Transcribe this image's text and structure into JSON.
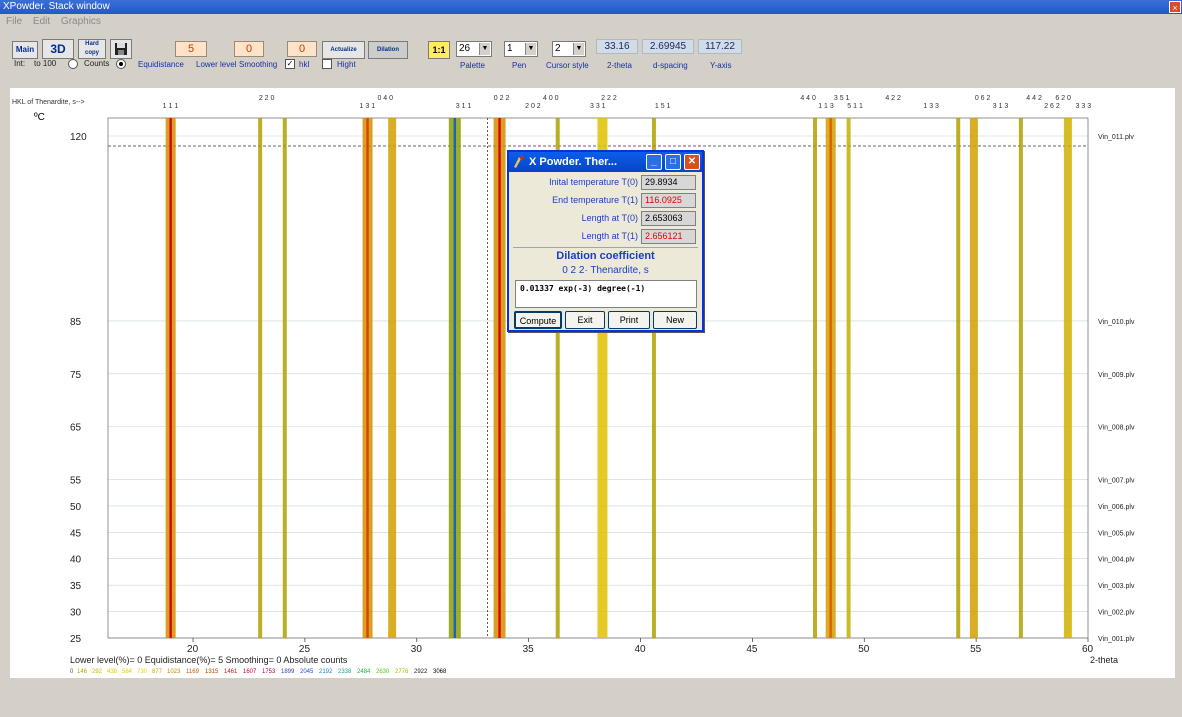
{
  "window": {
    "title": "XPowder. Stack window",
    "close_glyph": "×"
  },
  "menu": [
    "File",
    "Edit",
    "Graphics"
  ],
  "toolbar": {
    "main_label": "Main",
    "btn3d_label": "3D",
    "hardcopy_label": "Hard copy",
    "save_icon": "floppy-icon",
    "numbox1": "5",
    "numbox2": "0",
    "numbox3": "0",
    "actualize_label": "Actualize",
    "dilation_label": "Dilation",
    "ratio_label": "1:1",
    "palette_value": "26",
    "pen_value": "1",
    "cursor_value": "2",
    "two_theta_value": "33.16",
    "dspacing_value": "2.69945",
    "yaxis_value": "117.22",
    "int_label": "Int:",
    "to100_label": "to 100",
    "counts_label": "Counts",
    "equidistance_label": "Equidistance",
    "lowerlevel_label": "Lower level",
    "smoothing_label": "Smoothing",
    "hkl_label": "hkl",
    "hight_label": "Hight",
    "palette_label": "Palette",
    "pen_label": "Pen",
    "cursor_label": "Cursor style",
    "two_theta_label": "2-theta",
    "dspacing_label": "d-spacing",
    "yaxis_label": "Y-axis",
    "hkl_checked": true,
    "hight_checked": false,
    "int_mode": "counts"
  },
  "plot": {
    "hkl_caption": "HKL of Thenardite, s-->",
    "y_unit": "ºC",
    "x_label": "2-theta",
    "x_ticks": [
      20,
      25,
      30,
      35,
      40,
      45,
      50,
      55,
      60
    ],
    "y_levels": [
      {
        "t": "120",
        "file": "Vin_011.plv"
      },
      {
        "t": "85",
        "file": "Vin_010.plv"
      },
      {
        "t": "75",
        "file": "Vin_009.plv"
      },
      {
        "t": "65",
        "file": "Vin_008.plv"
      },
      {
        "t": "55",
        "file": "Vin_007.plv"
      },
      {
        "t": "50",
        "file": "Vin_006.plv"
      },
      {
        "t": "45",
        "file": "Vin_005.plv"
      },
      {
        "t": "40",
        "file": "Vin_004.plv"
      },
      {
        "t": "35",
        "file": "Vin_003.plv"
      },
      {
        "t": "30",
        "file": "Vin_002.plv"
      },
      {
        "t": "25",
        "file": "Vin_001.plv"
      }
    ],
    "hkl_labels": [
      {
        "two_theta": 19.0,
        "text": "1 1 1"
      },
      {
        "two_theta": 23.3,
        "text": "2 2 0"
      },
      {
        "two_theta": 27.8,
        "text": "1 3 1"
      },
      {
        "two_theta": 28.6,
        "text": "0 4 0"
      },
      {
        "two_theta": 32.1,
        "text": "3 1 1"
      },
      {
        "two_theta": 33.8,
        "text": "0 2 2"
      },
      {
        "two_theta": 35.2,
        "text": "2 0 2"
      },
      {
        "two_theta": 36.0,
        "text": "4 0 0"
      },
      {
        "two_theta": 38.1,
        "text": "3 3 1"
      },
      {
        "two_theta": 38.6,
        "text": "2 2 2"
      },
      {
        "two_theta": 41.0,
        "text": "1 5 1"
      },
      {
        "two_theta": 47.5,
        "text": "4 4 0"
      },
      {
        "two_theta": 48.3,
        "text": "1 1 3"
      },
      {
        "two_theta": 49.0,
        "text": "3 5 1"
      },
      {
        "two_theta": 49.6,
        "text": "5 1 1"
      },
      {
        "two_theta": 51.3,
        "text": "4 2 2"
      },
      {
        "two_theta": 53.0,
        "text": "1 3 3"
      },
      {
        "two_theta": 55.3,
        "text": "0 6 2"
      },
      {
        "two_theta": 56.1,
        "text": "3 1 3"
      },
      {
        "two_theta": 57.6,
        "text": "4 4 2"
      },
      {
        "two_theta": 58.4,
        "text": "2 6 2"
      },
      {
        "two_theta": 58.9,
        "text": "6 2 0"
      },
      {
        "two_theta": 59.8,
        "text": "3 3 3"
      }
    ],
    "status_text": "Lower level(%)= 0   Equidistance(%)= 5   Smoothing= 0   Absolute counts",
    "palette_values": [
      "0",
      "146",
      "292",
      "438",
      "584",
      "730",
      "877",
      "1023",
      "1169",
      "1315",
      "1461",
      "1607",
      "1753",
      "1899",
      "2045",
      "2192",
      "2338",
      "2484",
      "2630",
      "2776",
      "2922",
      "3068"
    ],
    "palette_colors": [
      "#555555",
      "#b8a000",
      "#c8b400",
      "#d8c800",
      "#e0d000",
      "#e8d800",
      "#d8a000",
      "#c88000",
      "#c06000",
      "#b84000",
      "#c02000",
      "#c00040",
      "#a00060",
      "#4040a0",
      "#2050c0",
      "#2080c0",
      "#20a080",
      "#20b040",
      "#60c020",
      "#a0c000",
      "#202020",
      "#000000"
    ]
  },
  "dialog": {
    "title": "X Powder. Ther...",
    "rows": [
      {
        "label": "Inital temperature T(0)",
        "value": "29.8934",
        "color": "#000000"
      },
      {
        "label": "End temperature T(1)",
        "value": "116.0925",
        "color": "#e00000"
      },
      {
        "label": "Length at T(0)",
        "value": "2.653063",
        "color": "#000000"
      },
      {
        "label": "Length at T(1)",
        "value": "2.656121",
        "color": "#e00000"
      }
    ],
    "heading": "Dilation coefficient",
    "subheading": "0  2  2· Thenardite, s",
    "result": "0.01337 exp(-3) degree(-1)",
    "buttons": [
      "Compute",
      "Exit",
      "Print",
      "New"
    ]
  }
}
